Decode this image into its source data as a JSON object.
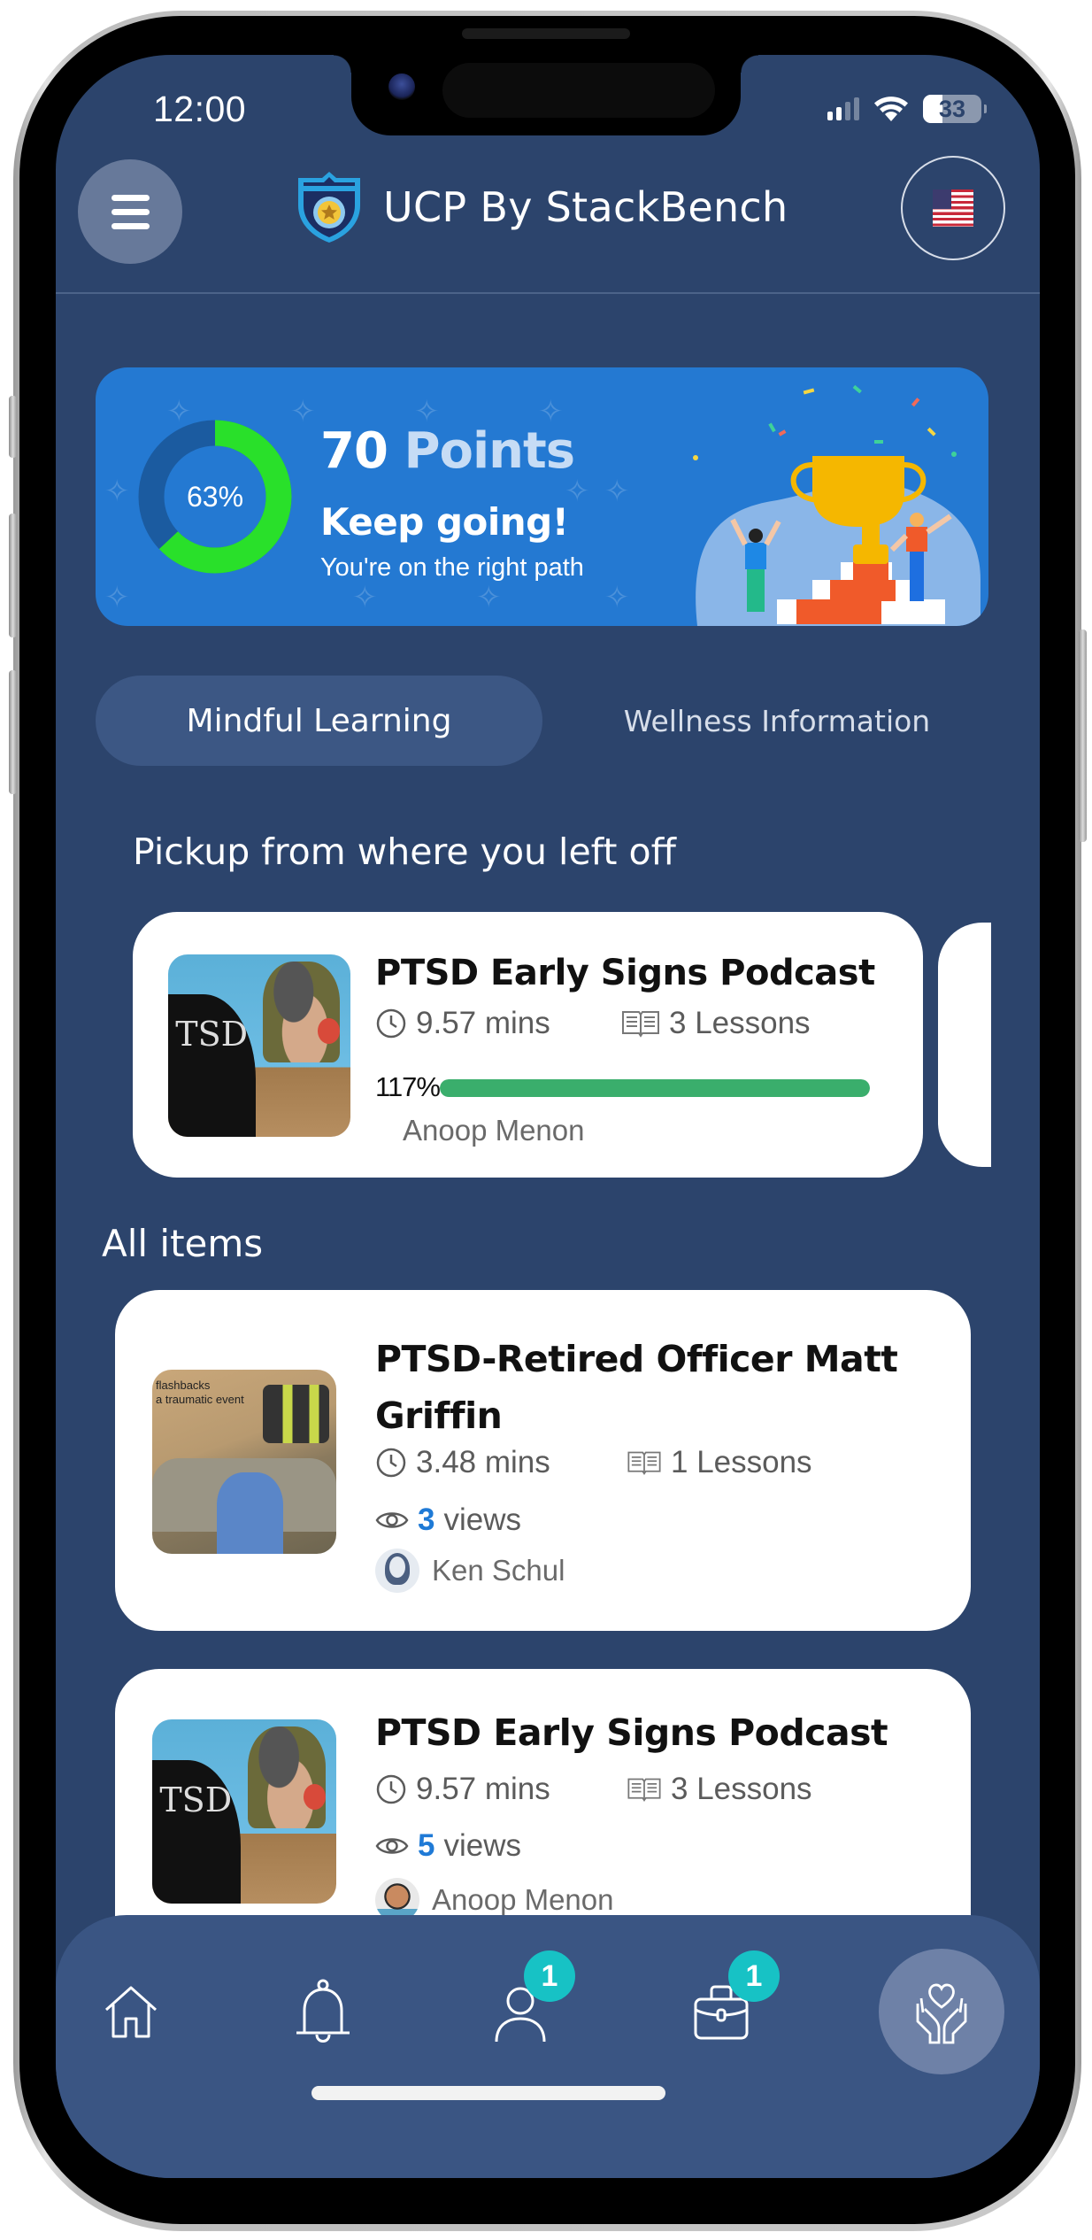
{
  "status_bar": {
    "time": "12:00",
    "battery_level": "33",
    "battery_fraction": 0.33,
    "signal_bars_active": 2,
    "signal_bars_total": 4
  },
  "header": {
    "menu_icon": "hamburger-menu-icon",
    "logo_icon": "police-shield-badge-icon",
    "title": "UCP By StackBench",
    "language_icon": "us-flag-icon"
  },
  "points_banner": {
    "progress_percent": 63,
    "progress_label": "63%",
    "points_value": "70",
    "points_word": "Points",
    "headline": "Keep going!",
    "subtext": "You're on the right path",
    "illustration": "trophy-celebration-illustration",
    "colors": {
      "background": "#2479d2",
      "ring_progress": "#29e02a",
      "ring_track": "#1b5ba0"
    }
  },
  "tabs": [
    {
      "label": "Mindful Learning",
      "active": true
    },
    {
      "label": "Wellness Information",
      "active": false
    }
  ],
  "pickup_section": {
    "title": "Pickup from where you left off",
    "items": [
      {
        "title": "PTSD Early Signs Podcast",
        "duration": "9.57 mins",
        "lessons": "3 Lessons",
        "progress_label": "117%",
        "progress_percent": 117,
        "author": "Anoop Menon",
        "thumbnail": "ptsd-head-silhouette-thumbnail"
      }
    ]
  },
  "all_items_section": {
    "title": "All items",
    "items": [
      {
        "title": "PTSD-Retired Officer Matt Griffin",
        "duration": "3.48 mins",
        "lessons": "1 Lessons",
        "views_count": "3",
        "views_label": "views",
        "author": "Ken Schul",
        "avatar": "default-avatar",
        "thumbnail": "flashbacks-traumatic-event-thumbnail",
        "thumbnail_text": "flashbacks\na traumatic event"
      },
      {
        "title": "PTSD Early Signs Podcast",
        "duration": "9.57 mins",
        "lessons": "3 Lessons",
        "views_count": "5",
        "views_label": "views",
        "author": "Anoop Menon",
        "avatar": "photo-avatar",
        "thumbnail": "ptsd-head-silhouette-thumbnail"
      }
    ]
  },
  "bottom_nav": {
    "items": [
      {
        "name": "home",
        "icon": "home-icon",
        "badge": null
      },
      {
        "name": "notifications",
        "icon": "bell-icon",
        "badge": null
      },
      {
        "name": "profile",
        "icon": "user-icon",
        "badge": "1"
      },
      {
        "name": "portfolio",
        "icon": "briefcase-icon",
        "badge": "1"
      },
      {
        "name": "wellness",
        "icon": "heart-hands-icon",
        "badge": null,
        "active": true
      }
    ],
    "badge_color": "#17c2c5"
  },
  "thumb_texts": {
    "ptsd": "TSD"
  }
}
